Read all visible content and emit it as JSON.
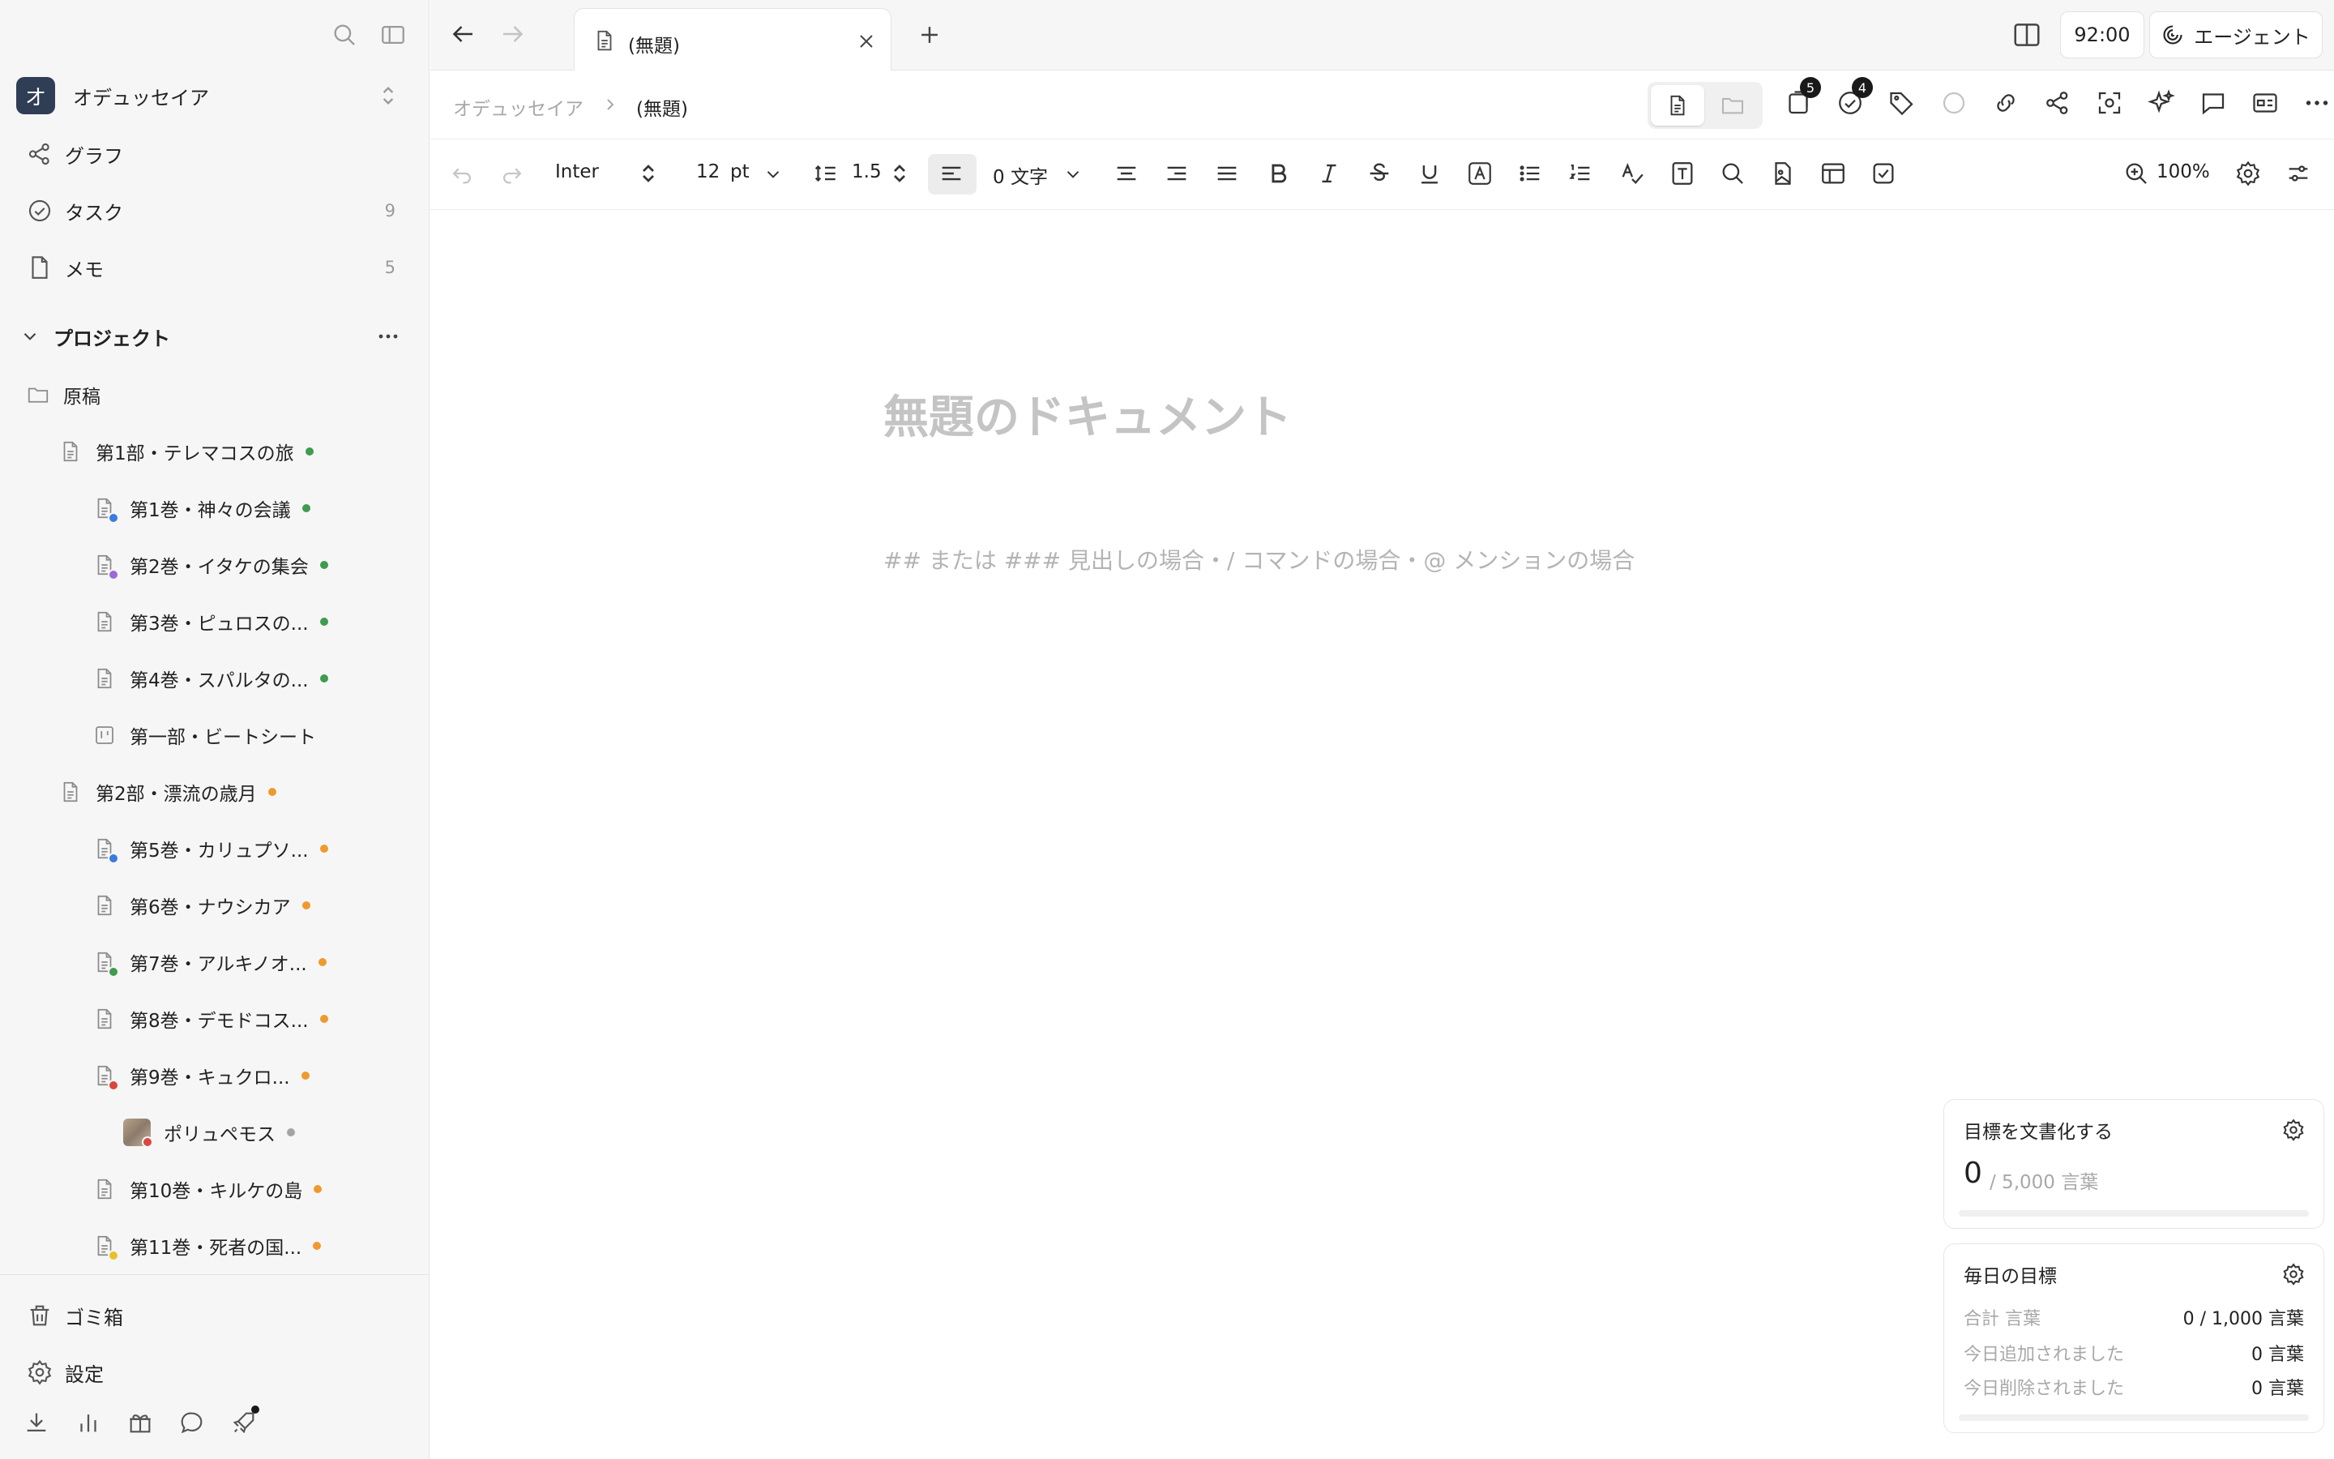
{
  "colors": {
    "accent_dark": "#2f3e55",
    "dot_green": "#3e9b4f",
    "dot_orange": "#ef9a2c",
    "dot_gray": "#a4a4a4",
    "dot_blue": "#3b7be0",
    "dot_purple": "#9a6ad8",
    "dot_red": "#d9473f",
    "dot_yellow": "#e9c229"
  },
  "sidebar": {
    "top_icons": [
      "search-icon",
      "sidebar-toggle-icon"
    ],
    "workspace": {
      "avatar_letter": "オ",
      "name": "オデュッセイア"
    },
    "nav": [
      {
        "label": "グラフ",
        "icon": "graph-icon",
        "count": ""
      },
      {
        "label": "タスク",
        "icon": "task-check-icon",
        "count": "9"
      },
      {
        "label": "メモ",
        "icon": "note-icon",
        "count": "5"
      }
    ],
    "projects_label": "プロジェクト",
    "tree": [
      {
        "label": "原稿",
        "icon": "folder-icon",
        "dot": ""
      },
      {
        "label": "第1部・テレマコスの旅",
        "icon": "document-icon",
        "dot": "green"
      },
      {
        "label": "第1巻・神々の会議",
        "icon": "document-icon",
        "dot": "green",
        "sub": "blue"
      },
      {
        "label": "第2巻・イタケの集会",
        "icon": "document-icon",
        "dot": "green",
        "sub": "purple"
      },
      {
        "label": "第3巻・ピュロスの...",
        "icon": "document-icon",
        "dot": "green"
      },
      {
        "label": "第4巻・スパルタの...",
        "icon": "document-icon",
        "dot": "green"
      },
      {
        "label": "第一部・ビートシート",
        "icon": "board-icon",
        "dot": ""
      },
      {
        "label": "第2部・漂流の歳月",
        "icon": "document-icon",
        "dot": "orange"
      },
      {
        "label": "第5巻・カリュプソ...",
        "icon": "document-icon",
        "dot": "orange",
        "sub": "blue"
      },
      {
        "label": "第6巻・ナウシカア",
        "icon": "document-icon",
        "dot": "orange"
      },
      {
        "label": "第7巻・アルキノオ...",
        "icon": "document-icon",
        "dot": "orange",
        "sub": "green"
      },
      {
        "label": "第8巻・デモドコス...",
        "icon": "document-icon",
        "dot": "orange"
      },
      {
        "label": "第9巻・キュクロ...",
        "icon": "document-icon",
        "dot": "orange",
        "sub": "red"
      },
      {
        "label": "ポリュペモス",
        "icon": "character-thumbnail",
        "dot": "gray",
        "sub": "red"
      },
      {
        "label": "第10巻・キルケの島",
        "icon": "document-icon",
        "dot": "orange"
      },
      {
        "label": "第11巻・死者の国...",
        "icon": "document-icon",
        "dot": "orange",
        "sub": "yellow"
      }
    ],
    "trash_label": "ゴミ箱",
    "settings_label": "設定",
    "bottom_icons": [
      "download-icon",
      "stats-icon",
      "gift-icon",
      "chat-icon",
      "rocket-icon"
    ]
  },
  "tabbar": {
    "tab_title": "(無題)",
    "timer": "92:00",
    "agent_label": "エージェント"
  },
  "breadcrumb": {
    "project": "オデュッセイア",
    "current": "(無題)",
    "badge_a": "5",
    "badge_b": "4"
  },
  "format_toolbar": {
    "font": "Inter",
    "size": "12",
    "size_unit": "pt",
    "line_height": "1.5",
    "word_count": "0 文字",
    "zoom": "100%"
  },
  "editor": {
    "title_placeholder": "無題のドキュメント",
    "body_hint": "## または ### 見出しの場合・/ コマンドの場合・@ メンションの場合"
  },
  "goal_widget": {
    "title": "目標を文書化する",
    "current": "0",
    "target": "/ 5,000 言葉",
    "progress": 0
  },
  "daily_widget": {
    "title": "毎日の目標",
    "rows": [
      {
        "label": "合計 言葉",
        "value": "0 / 1,000 言葉"
      },
      {
        "label": "今日追加されました",
        "value": "0 言葉"
      },
      {
        "label": "今日削除されました",
        "value": "0 言葉"
      }
    ],
    "progress": 0
  }
}
